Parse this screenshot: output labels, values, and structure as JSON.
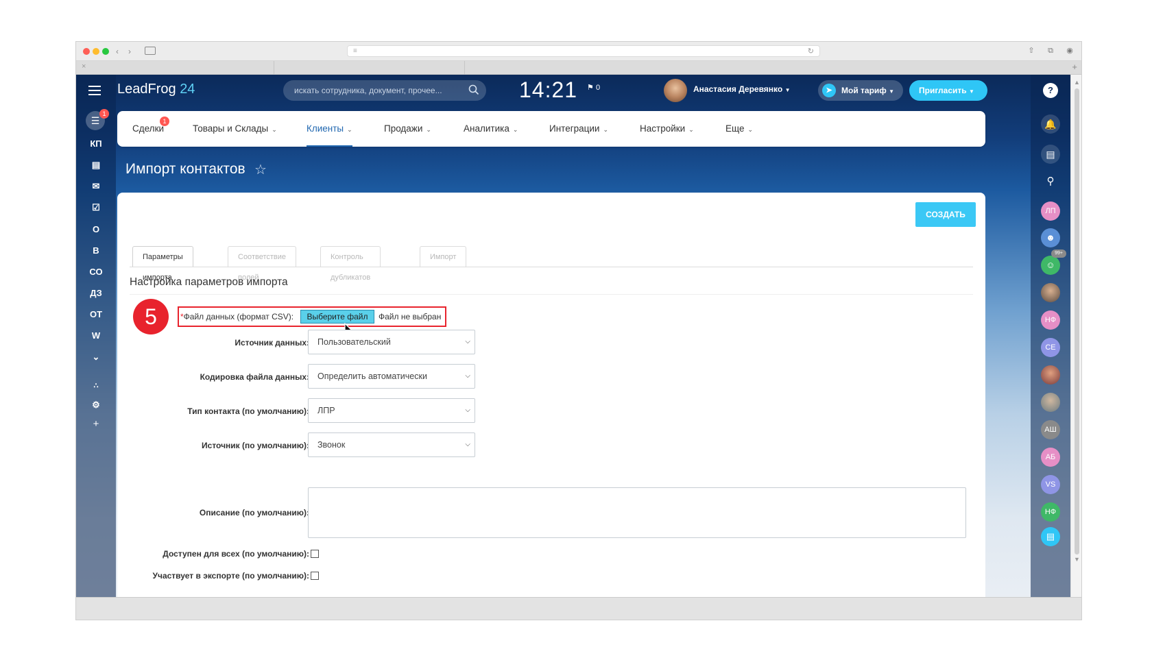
{
  "header": {
    "logo_text": "LeadFrog",
    "logo_num": "24",
    "search_placeholder": "искать сотрудника, документ, прочее...",
    "clock": "14:21",
    "flag_count": "0",
    "user_name": "Анастасия Деревянко",
    "tariff_label": "Мой тариф",
    "invite_label": "Пригласить",
    "help_label": "?"
  },
  "leftbar": {
    "badge": "1",
    "items": [
      "КП",
      "О",
      "В",
      "СО",
      "ДЗ",
      "ОТ",
      "W"
    ]
  },
  "nav": {
    "items": [
      "Сделки",
      "Товары и Склады",
      "Клиенты",
      "Продажи",
      "Аналитика",
      "Интеграции",
      "Настройки",
      "Еще"
    ],
    "badge": "1",
    "active": "Клиенты"
  },
  "page": {
    "title": "Импорт контактов",
    "create_button": "СОЗДАТЬ",
    "tabs": [
      "Параметры импорта",
      "Соответствие полей",
      "Контроль дубликатов",
      "Импорт"
    ],
    "section_title": "Настройка параметров импорта",
    "step_number": "5"
  },
  "form": {
    "file_label_req": "*",
    "file_label": "Файл данных (формат CSV):",
    "file_button": "Выберите файл",
    "file_status": "Файл не выбран",
    "fields": [
      {
        "label": "Источник данных:",
        "value": "Пользовательский"
      },
      {
        "label": "Кодировка файла данных:",
        "value": "Определить автоматически"
      },
      {
        "label": "Тип контакта (по умолчанию):",
        "value": "ЛПР"
      },
      {
        "label": "Источник (по умолчанию):",
        "value": "Звонок"
      }
    ],
    "description_label": "Описание (по умолчанию):",
    "description_value": "",
    "checkbox_public_label": "Доступен для всех (по умолчанию):",
    "checkbox_public_checked": false,
    "checkbox_export_label": "Участвует в экспорте (по умолчанию):",
    "checkbox_export_checked": false
  },
  "rightbar": {
    "avatars": [
      {
        "initials": "ЛП",
        "color": "#e68fc6"
      },
      {
        "initials": "НФ",
        "color": "#e68fc6"
      },
      {
        "initials": "СЕ",
        "color": "#8f95e6"
      },
      {
        "initials": "АШ",
        "color": "#8a8a8a"
      },
      {
        "initials": "АБ",
        "color": "#e68fc6"
      },
      {
        "initials": "VS",
        "color": "#8f95e6"
      },
      {
        "initials": "НФ",
        "color": "#3fb867"
      }
    ],
    "badge_99": "99+"
  },
  "colors": {
    "accent": "#2fc6f6",
    "active_nav": "#2067b0",
    "highlight": "#e8232d"
  }
}
